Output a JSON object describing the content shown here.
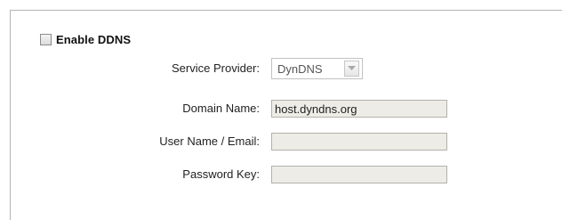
{
  "ddns": {
    "enable_label": "Enable DDNS",
    "enabled": false,
    "fields": {
      "service_provider": {
        "label": "Service Provider:",
        "value": "DynDNS"
      },
      "domain_name": {
        "label": "Domain Name:",
        "value": "host.dyndns.org"
      },
      "user_name": {
        "label": "User Name / Email:",
        "value": ""
      },
      "password_key": {
        "label": "Password Key:",
        "value": ""
      }
    }
  },
  "icons": {
    "dropdown": "chevron-down-icon",
    "checkbox": "checkbox-unchecked-icon"
  }
}
